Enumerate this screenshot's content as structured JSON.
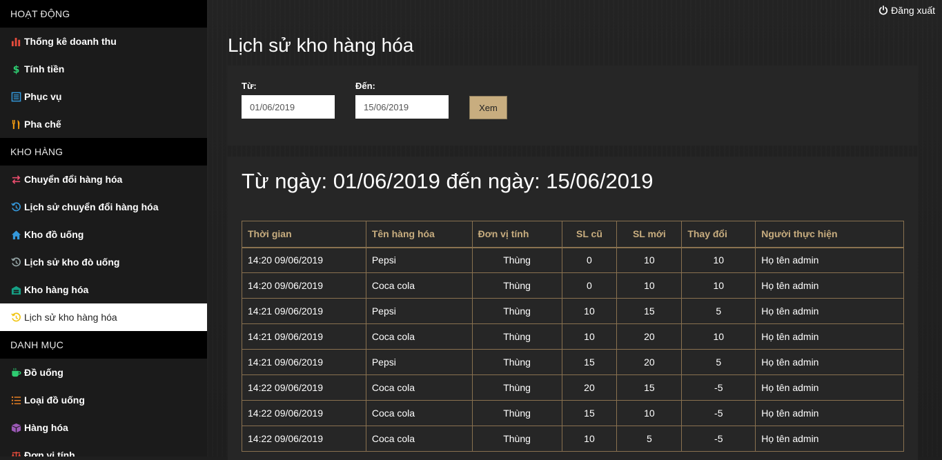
{
  "sidebar": {
    "sections": [
      {
        "header": "HOẠT ĐỘNG",
        "items": [
          {
            "label": "Thống kê doanh thu",
            "icon": "bar-chart-icon",
            "color": "#e74c3c"
          },
          {
            "label": "Tính tiền",
            "icon": "dollar-icon",
            "color": "#2ecc71"
          },
          {
            "label": "Phục vụ",
            "icon": "list-icon",
            "color": "#3498db"
          },
          {
            "label": "Pha chế",
            "icon": "utensils-icon",
            "color": "#f39c12"
          }
        ]
      },
      {
        "header": "KHO HÀNG",
        "items": [
          {
            "label": "Chuyển đổi hàng hóa",
            "icon": "exchange-icon",
            "color": "#e74c6c"
          },
          {
            "label": "Lịch sử chuyển đổi hàng hóa",
            "icon": "history-icon",
            "color": "#3498db"
          },
          {
            "label": "Kho đồ uống",
            "icon": "home-icon",
            "color": "#3498db"
          },
          {
            "label": "Lịch sử kho đò uống",
            "icon": "history-icon",
            "color": "#95a5a6"
          },
          {
            "label": "Kho hàng hóa",
            "icon": "warehouse-icon",
            "color": "#16a085"
          },
          {
            "label": "Lịch sử kho hàng hóa",
            "icon": "history-icon",
            "color": "#f1c40f",
            "active": true
          }
        ]
      },
      {
        "header": "DANH MỤC",
        "items": [
          {
            "label": "Đồ uống",
            "icon": "coffee-icon",
            "color": "#2ecc71"
          },
          {
            "label": "Loại đồ uống",
            "icon": "list-ordered-icon",
            "color": "#e67e22"
          },
          {
            "label": "Hàng hóa",
            "icon": "box-icon",
            "color": "#9b59b6"
          },
          {
            "label": "Đơn vị tính",
            "icon": "scale-icon",
            "color": "#e74c3c"
          }
        ]
      }
    ]
  },
  "header": {
    "logout_label": "Đăng xuất"
  },
  "page": {
    "title": "Lịch sử kho hàng hóa"
  },
  "filter": {
    "from_label": "Từ:",
    "from_value": "01/06/2019",
    "to_label": "Đến:",
    "to_value": "15/06/2019",
    "view_button": "Xem"
  },
  "result": {
    "range_title": "Từ ngày: 01/06/2019 đến ngày: 15/06/2019",
    "columns": [
      "Thời gian",
      "Tên hàng hóa",
      "Đơn vị tính",
      "SL cũ",
      "SL mới",
      "Thay đổi",
      "Người thực hiện"
    ],
    "rows": [
      [
        "14:20 09/06/2019",
        "Pepsi",
        "Thùng",
        "0",
        "10",
        "10",
        "Họ tên admin"
      ],
      [
        "14:20 09/06/2019",
        "Coca cola",
        "Thùng",
        "0",
        "10",
        "10",
        "Họ tên admin"
      ],
      [
        "14:21 09/06/2019",
        "Pepsi",
        "Thùng",
        "10",
        "15",
        "5",
        "Họ tên admin"
      ],
      [
        "14:21 09/06/2019",
        "Coca cola",
        "Thùng",
        "10",
        "20",
        "10",
        "Họ tên admin"
      ],
      [
        "14:21 09/06/2019",
        "Pepsi",
        "Thùng",
        "15",
        "20",
        "5",
        "Họ tên admin"
      ],
      [
        "14:22 09/06/2019",
        "Coca cola",
        "Thùng",
        "20",
        "15",
        "-5",
        "Họ tên admin"
      ],
      [
        "14:22 09/06/2019",
        "Coca cola",
        "Thùng",
        "15",
        "10",
        "-5",
        "Họ tên admin"
      ],
      [
        "14:22 09/06/2019",
        "Coca cola",
        "Thùng",
        "10",
        "5",
        "-5",
        "Họ tên admin"
      ]
    ]
  },
  "colors": {
    "accent": "#c8ad7f",
    "table_border": "#8a7250",
    "sidebar_bg": "#1b1b1b",
    "section_header_bg": "#000000"
  }
}
